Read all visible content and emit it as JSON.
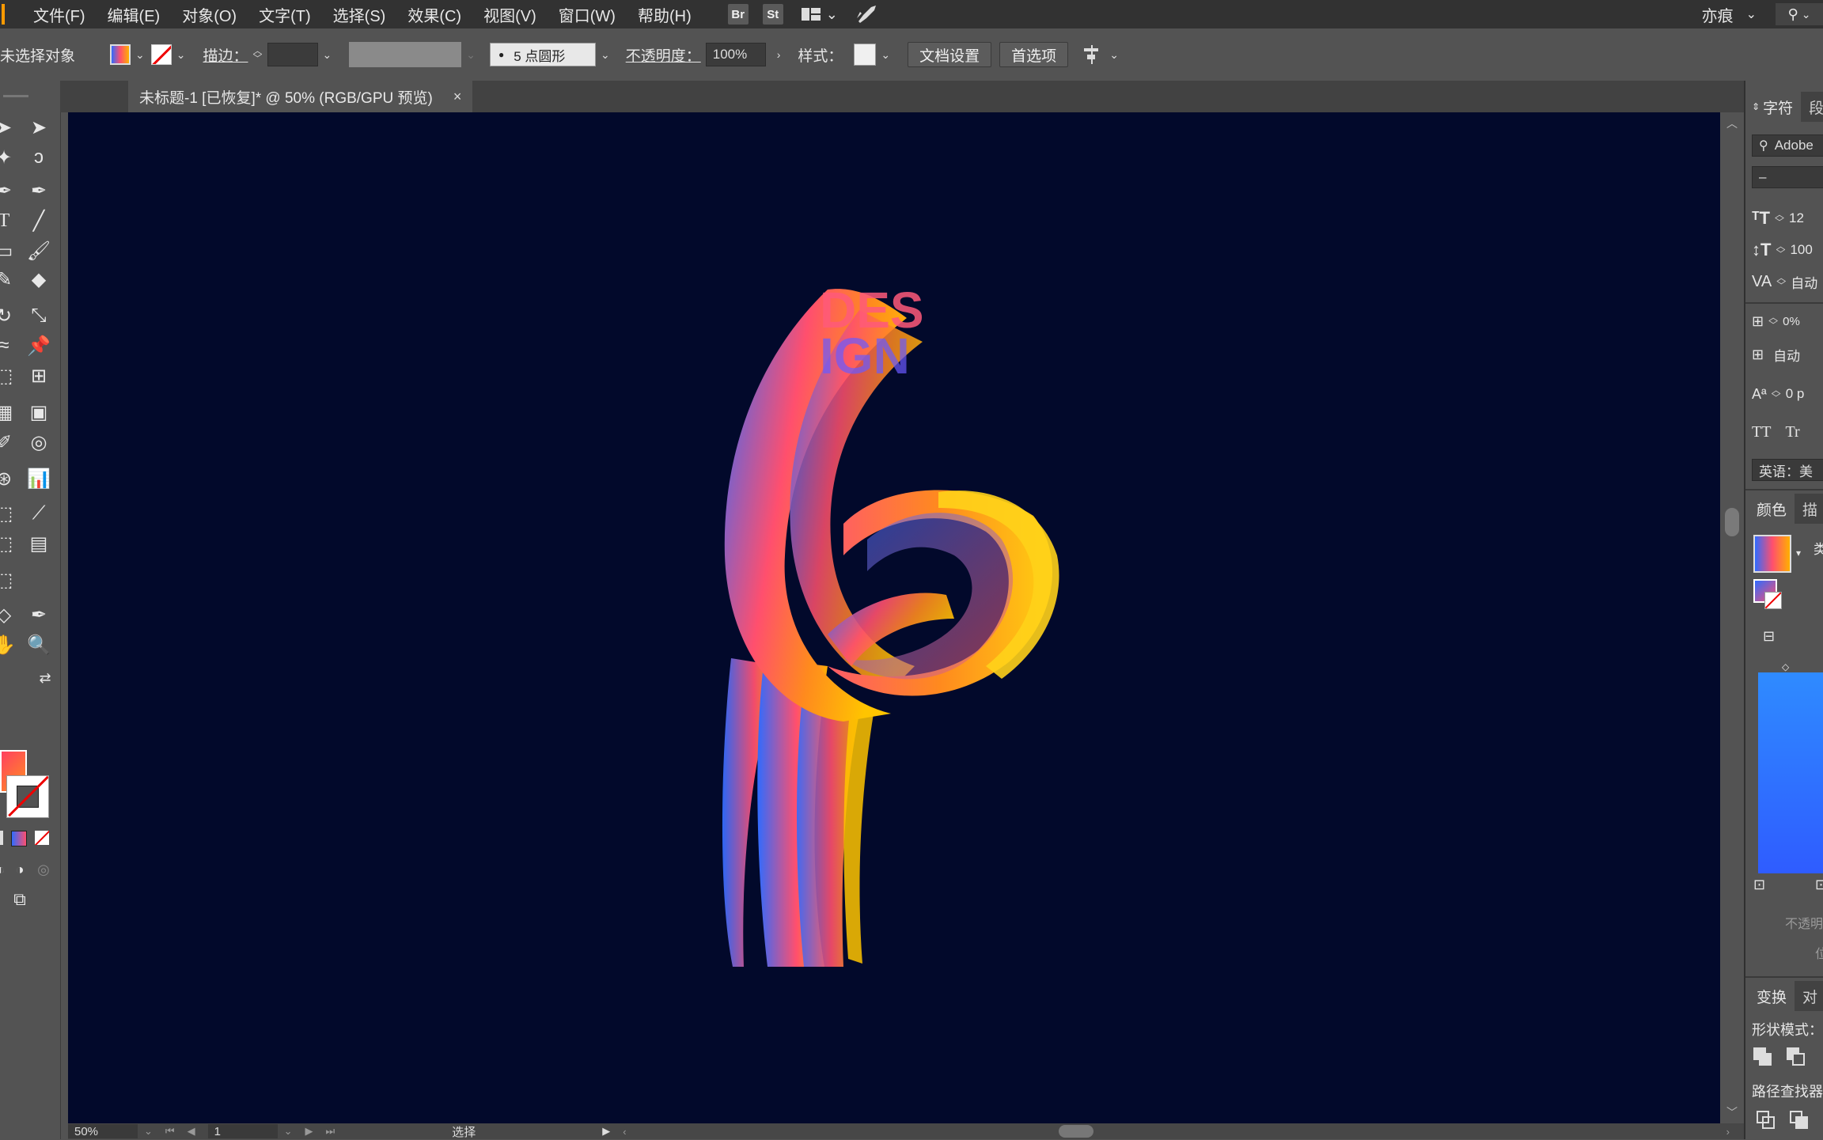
{
  "menu": {
    "items": [
      "文件(F)",
      "编辑(E)",
      "对象(O)",
      "文字(T)",
      "选择(S)",
      "效果(C)",
      "视图(V)",
      "窗口(W)",
      "帮助(H)"
    ],
    "bridge_label": "Br",
    "stock_label": "St",
    "user": "亦痕"
  },
  "control": {
    "selection_status": "未选择对象",
    "stroke_label": "描边：",
    "brush_value": "5 点圆形",
    "opacity_label": "不透明度：",
    "opacity_value": "100%",
    "style_label": "样式：",
    "doc_setup_button": "文档设置",
    "preferences_button": "首选项"
  },
  "document": {
    "tab_title": "未标题-1 [已恢复]* @ 50% (RGB/GPU 预览)",
    "close_glyph": "×",
    "artwork_text_line1": "DES",
    "artwork_text_line2": "IGN"
  },
  "status": {
    "zoom": "50%",
    "page": "1",
    "mode": "选择"
  },
  "character_panel": {
    "tab_active": "字符",
    "tab_next": "段",
    "font_name": "Adobe",
    "font_style": "–",
    "size_value": "12",
    "leading_value": "100",
    "tracking_value": "自动",
    "percent_value": "0%",
    "auto_label": "自动",
    "baseline_value": "0 p",
    "caps_all": "TT",
    "caps_small": "Tr",
    "language": "英语：美"
  },
  "color_panel": {
    "tab_active": "颜色",
    "tab_next": "描",
    "type_label": "类",
    "opacity_label": "不透明",
    "location_label": "位"
  },
  "transform_panel": {
    "tab_active": "变换",
    "tab_next": "对",
    "shape_modes_label": "形状模式：",
    "pathfinder_label": "路径查找器"
  },
  "colors": {
    "canvas_bg": "#02092b",
    "ribbon_blue": "#2f6bff",
    "ribbon_pink": "#ff4f6e",
    "ribbon_orange": "#ff8a1e",
    "ribbon_yellow": "#ffc400"
  }
}
